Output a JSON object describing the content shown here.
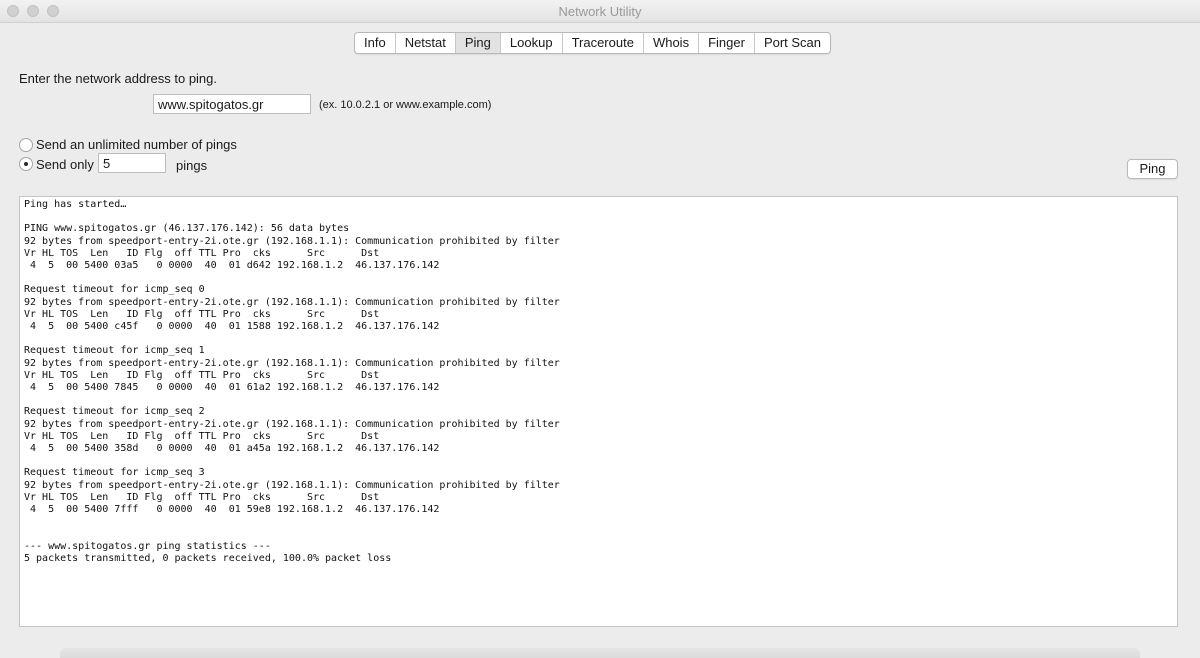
{
  "window": {
    "title": "Network Utility"
  },
  "tabs": [
    {
      "label": "Info",
      "selected": false
    },
    {
      "label": "Netstat",
      "selected": false
    },
    {
      "label": "Ping",
      "selected": true
    },
    {
      "label": "Lookup",
      "selected": false
    },
    {
      "label": "Traceroute",
      "selected": false
    },
    {
      "label": "Whois",
      "selected": false
    },
    {
      "label": "Finger",
      "selected": false
    },
    {
      "label": "Port Scan",
      "selected": false
    }
  ],
  "ping_form": {
    "prompt": "Enter the network address to ping.",
    "address_value": "www.spitogatos.gr",
    "address_hint": "(ex. 10.0.2.1 or www.example.com)",
    "option_unlimited_label": "Send an unlimited number of pings",
    "option_unlimited_selected": false,
    "option_count_label": "Send only",
    "option_count_selected": true,
    "count_value": "5",
    "count_suffix": "pings",
    "ping_button_label": "Ping"
  },
  "output": {
    "lines": [
      "Ping has started…",
      "",
      "PING www.spitogatos.gr (46.137.176.142): 56 data bytes",
      "92 bytes from speedport-entry-2i.ote.gr (192.168.1.1): Communication prohibited by filter",
      "Vr HL TOS  Len   ID Flg  off TTL Pro  cks      Src      Dst",
      " 4  5  00 5400 03a5   0 0000  40  01 d642 192.168.1.2  46.137.176.142",
      "",
      "Request timeout for icmp_seq 0",
      "92 bytes from speedport-entry-2i.ote.gr (192.168.1.1): Communication prohibited by filter",
      "Vr HL TOS  Len   ID Flg  off TTL Pro  cks      Src      Dst",
      " 4  5  00 5400 c45f   0 0000  40  01 1588 192.168.1.2  46.137.176.142",
      "",
      "Request timeout for icmp_seq 1",
      "92 bytes from speedport-entry-2i.ote.gr (192.168.1.1): Communication prohibited by filter",
      "Vr HL TOS  Len   ID Flg  off TTL Pro  cks      Src      Dst",
      " 4  5  00 5400 7845   0 0000  40  01 61a2 192.168.1.2  46.137.176.142",
      "",
      "Request timeout for icmp_seq 2",
      "92 bytes from speedport-entry-2i.ote.gr (192.168.1.1): Communication prohibited by filter",
      "Vr HL TOS  Len   ID Flg  off TTL Pro  cks      Src      Dst",
      " 4  5  00 5400 358d   0 0000  40  01 a45a 192.168.1.2  46.137.176.142",
      "",
      "Request timeout for icmp_seq 3",
      "92 bytes from speedport-entry-2i.ote.gr (192.168.1.1): Communication prohibited by filter",
      "Vr HL TOS  Len   ID Flg  off TTL Pro  cks      Src      Dst",
      " 4  5  00 5400 7fff   0 0000  40  01 59e8 192.168.1.2  46.137.176.142",
      "",
      "",
      "--- www.spitogatos.gr ping statistics ---",
      "5 packets transmitted, 0 packets received, 100.0% packet loss"
    ]
  },
  "colors": {
    "window_bg": "#ececec",
    "titlebar_text": "#9a9a9a",
    "selected_tab_bg": "#e2e2e2",
    "output_bg": "#ffffff"
  }
}
